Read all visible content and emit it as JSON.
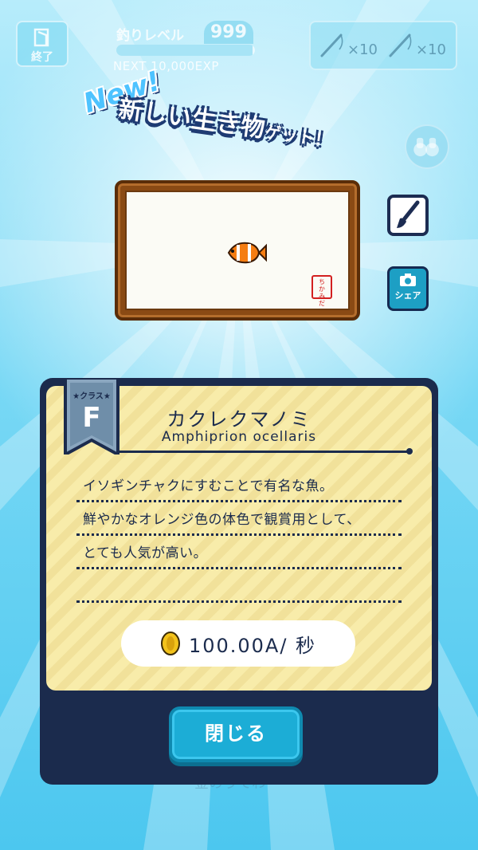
{
  "top": {
    "quit_label": "終了",
    "level_label": "釣りレベル",
    "level_value": "999",
    "level_progress": 0.98,
    "next_text": "NEXT  10,000EXP",
    "rods": [
      {
        "icon": "fishing-rod-icon",
        "count": "×10"
      },
      {
        "icon": "fishing-rod-icon",
        "count": "×10"
      }
    ]
  },
  "banner": {
    "new_tag": "New!",
    "title_main": "新しい生き物",
    "title_small": "ゲット！"
  },
  "frame": {
    "stamp_text": "ちかみだ"
  },
  "side_buttons": {
    "share_label": "シェア"
  },
  "card": {
    "class_label": "★クラス★",
    "class_grade": "F",
    "name_jp": "カクレクマノミ",
    "name_en": "Amphiprion ocellaris",
    "description": [
      "イソギンチャクにすむことで有名な魚。",
      "鮮やかなオレンジ色の体色で観賞用として、",
      "とても人気が高い。",
      ""
    ],
    "income": "100.00A/ 秒",
    "close_label": "閉じる"
  },
  "colors": {
    "navy": "#1b2b4d",
    "card_yellow": "#f8ecaa",
    "accent_blue": "#1cadd6",
    "sky": "#52c9ef"
  }
}
